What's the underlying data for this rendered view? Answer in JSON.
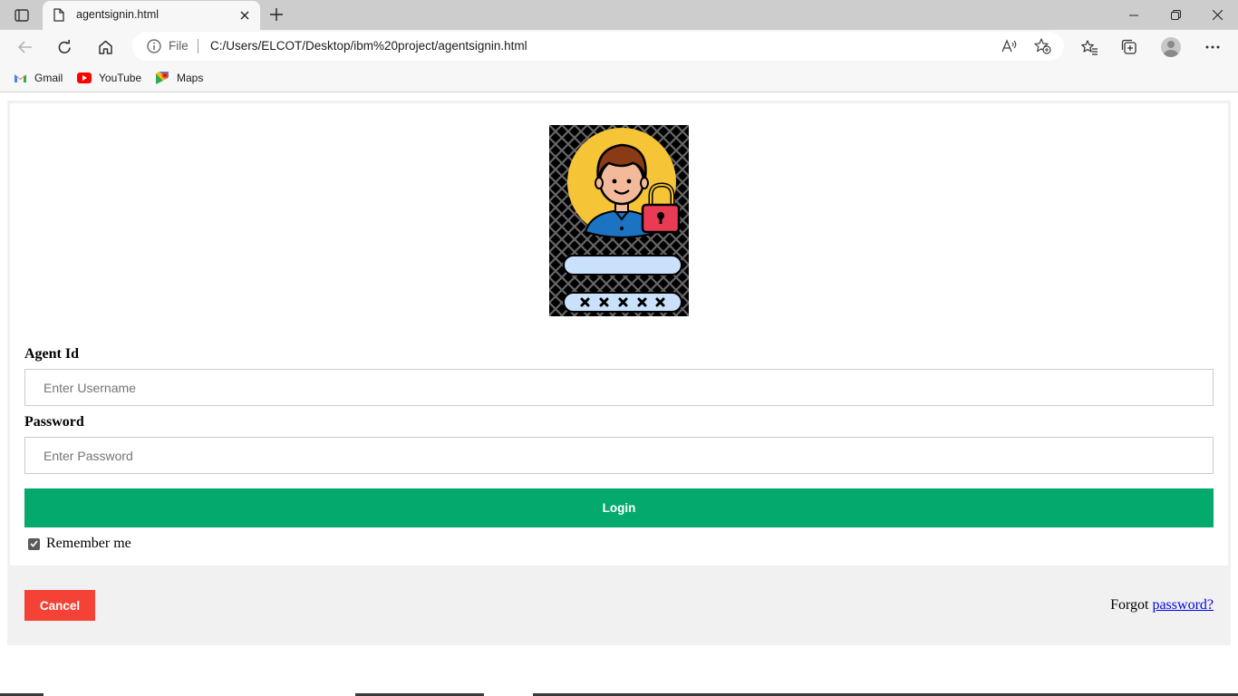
{
  "browser": {
    "tab_title": "agentsignin.html",
    "address": {
      "protocol_label": "File",
      "url": "C:/Users/ELCOT/Desktop/ibm%20project/agentsignin.html"
    },
    "bookmarks": [
      {
        "label": "Gmail",
        "icon": "gmail-icon"
      },
      {
        "label": "YouTube",
        "icon": "youtube-icon"
      },
      {
        "label": "Maps",
        "icon": "maps-icon"
      }
    ]
  },
  "form": {
    "agent_id_label": "Agent Id",
    "username_placeholder": "Enter Username",
    "password_label": "Password",
    "password_placeholder": "Enter Password",
    "login_label": "Login",
    "remember_label": "Remember me",
    "remember_checked": true
  },
  "footer": {
    "cancel_label": "Cancel",
    "forgot_prefix": "Forgot",
    "forgot_link": "password?"
  },
  "colors": {
    "login": "#04aa6d",
    "cancel": "#f44336",
    "link": "#0000ee"
  }
}
